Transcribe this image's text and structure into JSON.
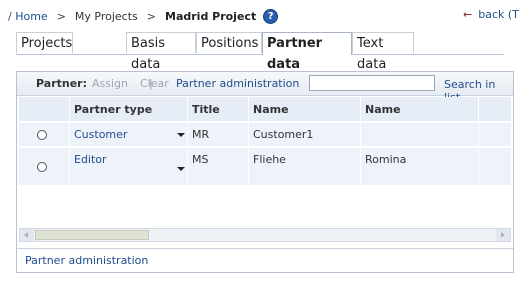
{
  "breadcrumb": {
    "home": "/ Home",
    "sep1": ">",
    "projects": "My Projects",
    "sep2": ">",
    "current": "Madrid Project",
    "help": "?"
  },
  "back": {
    "arrow": "←",
    "label": "back  (T"
  },
  "tabs": [
    "Projects",
    "Basis data",
    "Positions",
    "Partner data",
    "Text data"
  ],
  "active_tab": "Partner data",
  "toolbar": {
    "label": "Partner:",
    "assign": "Assign",
    "pipe": "|",
    "clear": "Clear",
    "admin": "Partner administration",
    "search_value": "",
    "search_button": "Search in list"
  },
  "table": {
    "headers": [
      "Partner type",
      "Title",
      "Name",
      "Name"
    ],
    "rows": [
      {
        "type": "Customer",
        "title": "MR",
        "name": "Customer1",
        "name2": ""
      },
      {
        "type": "Editor",
        "title": "MS",
        "name": "Fliehe",
        "name2": "Romina"
      }
    ]
  },
  "footer": {
    "link": "Partner administration"
  },
  "colors": {
    "link": "#1f4e8c",
    "row_bg": "#eef2fa",
    "header_bg": "#e6edf7",
    "border": "#b7c3d3"
  }
}
